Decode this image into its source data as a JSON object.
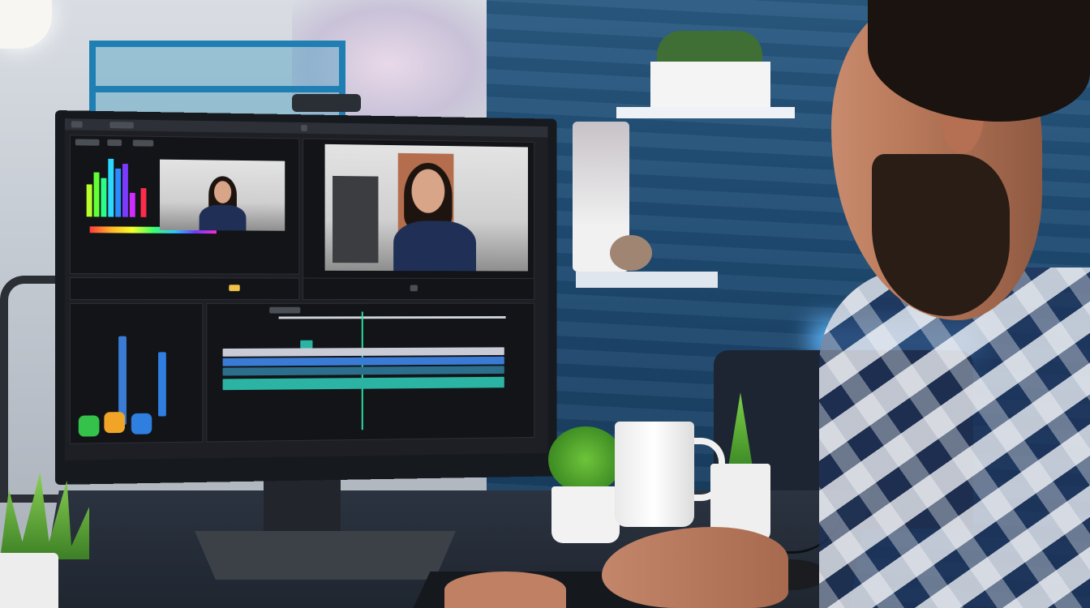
{
  "scene": {
    "description_tag": "video-editor-at-desk",
    "colors": {
      "wall_blue": "#1f4b73",
      "screen_bg": "#1d1f24",
      "timeline_track_teal": "#2bb3a3",
      "timeline_track_blue": "#3a7bd5",
      "playhead": "#2ee6a0",
      "button_green": "#35c24a",
      "button_orange": "#f0a526",
      "button_blue": "#2f7fe0"
    }
  },
  "editor": {
    "icons": {
      "record": "record-icon",
      "settings": "gear-icon",
      "play": "play-icon"
    }
  }
}
